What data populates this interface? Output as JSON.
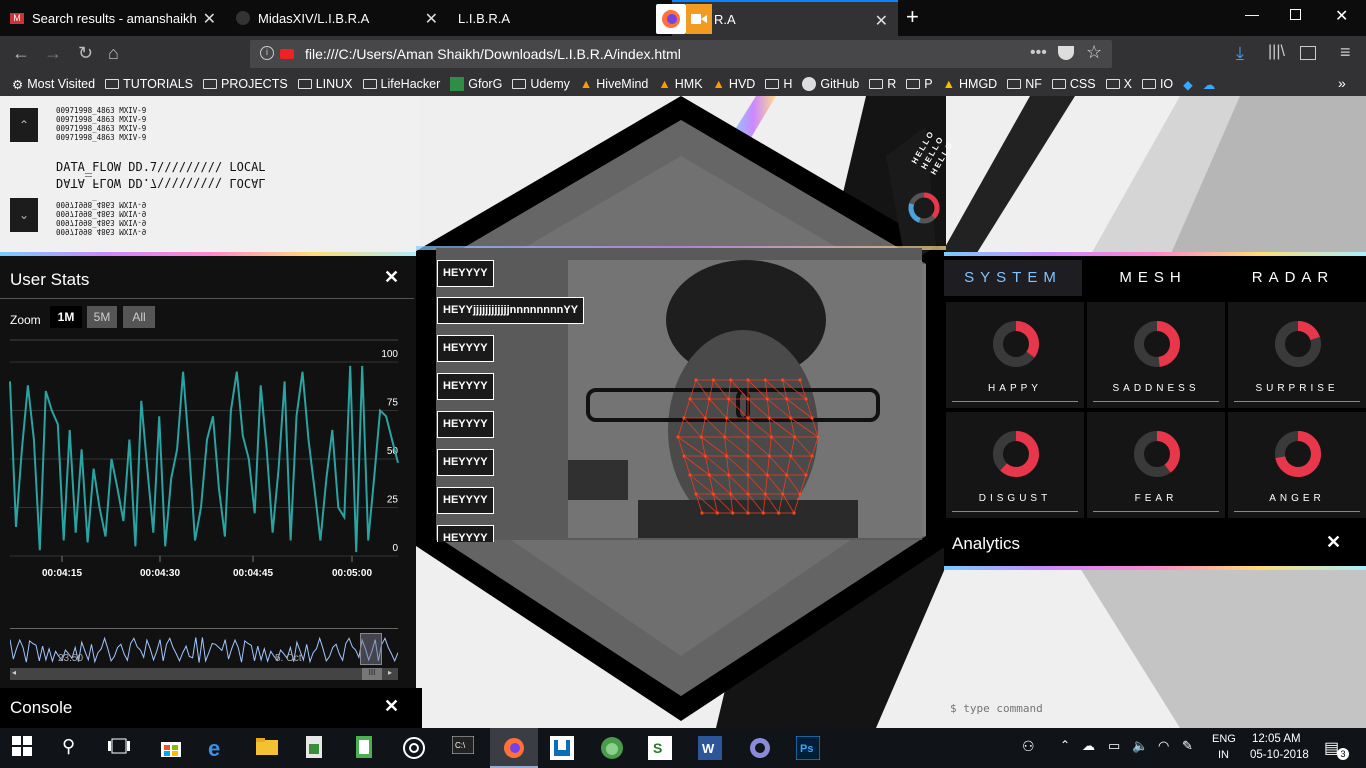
{
  "browser": {
    "tabs": [
      {
        "title": "Search results - amanshaikh.ar"
      },
      {
        "title": "MidasXIV/L.I.B.R.A"
      },
      {
        "title": "L.I.B.R.A"
      },
      {
        "title": "R.A"
      }
    ],
    "url": "file:///C:/Users/Aman Shaikh/Downloads/L.I.B.R.A/index.html",
    "bookmarks": [
      "Most Visited",
      "TUTORIALS",
      "PROJECTS",
      "LINUX",
      "LifeHacker",
      "GforG",
      "Udemy",
      "HiveMind",
      "HMK",
      "HVD",
      "H",
      "GitHub",
      "R",
      "P",
      "HMGD",
      "NF",
      "CSS",
      "X",
      "IO"
    ]
  },
  "data_flow": {
    "lines_top": [
      "00971998_4863 MXIV-9",
      "00971998_4863 MXIV-9",
      "00971998_4863 MXIV-9",
      "00971998_4863 MXIV-9"
    ],
    "main": "DATA_FLOW DD.7///////// LOCAL",
    "main_mirror": "DATA_FLOW DD.7\\\\\\\\\\\\\\\\\\ LOCAL",
    "lines_bottom": [
      "00971998_4863 MXIV-9",
      "00971998_4863 MXIV-9",
      "00971998_4863 MXIV-9",
      "00971998_4863 MXIV-9"
    ]
  },
  "user_stats": {
    "title": "User Stats",
    "zoom_label": "Zoom",
    "zoom_options": [
      "1M",
      "5M",
      "All"
    ],
    "zoom_selected": "1M",
    "navigator_labels": [
      "23:50",
      "5. Oct"
    ]
  },
  "chart_data": {
    "type": "line",
    "x": [
      "00:04:15",
      "00:04:30",
      "00:04:45",
      "00:05:00"
    ],
    "ylim": [
      0,
      100
    ],
    "yticks": [
      0,
      25,
      50,
      75,
      100
    ],
    "series": [
      {
        "values": [
          90,
          15,
          55,
          88,
          60,
          3,
          85,
          75,
          68,
          8,
          65,
          12,
          55,
          7,
          45,
          25,
          10,
          50,
          35,
          18,
          60,
          5,
          80,
          45,
          12,
          72,
          5,
          40,
          55,
          95,
          55,
          8,
          25,
          60,
          72,
          35,
          10,
          75,
          95,
          62,
          50,
          22,
          88,
          55,
          12,
          45,
          90,
          8,
          72,
          95,
          60,
          35,
          8,
          40,
          65,
          25,
          20,
          98,
          2,
          98,
          8,
          40,
          75,
          72,
          60,
          48
        ]
      }
    ]
  },
  "messages": [
    "HEYYYY",
    "HEYYjjjjjjjjjjjjnnnnnnnnYY",
    "HEYYYY",
    "HEYYYY",
    "HEYYYY",
    "HEYYYY",
    "HEYYYY",
    "HEYYYY"
  ],
  "hello": [
    "HELLO",
    "HELLO",
    "HELLO"
  ],
  "panel": {
    "tabs": [
      "SYSTEM",
      "MESH",
      "RADAR"
    ],
    "emotions": [
      {
        "label": "HAPPY",
        "value": 0.35
      },
      {
        "label": "SADDNESS",
        "value": 0.48
      },
      {
        "label": "SURPRISE",
        "value": 0.2
      },
      {
        "label": "DISGUST",
        "value": 0.62
      },
      {
        "label": "FEAR",
        "value": 0.4
      },
      {
        "label": "ANGER",
        "value": 0.72
      }
    ],
    "accent": "#e8364a"
  },
  "analytics": {
    "title": "Analytics",
    "command_placeholder": "$ type command"
  },
  "console": {
    "title": "Console"
  },
  "taskbar": {
    "lang1": "ENG",
    "lang2": "IN",
    "time": "12:05 AM",
    "date": "05-10-2018",
    "notifications": "3"
  }
}
